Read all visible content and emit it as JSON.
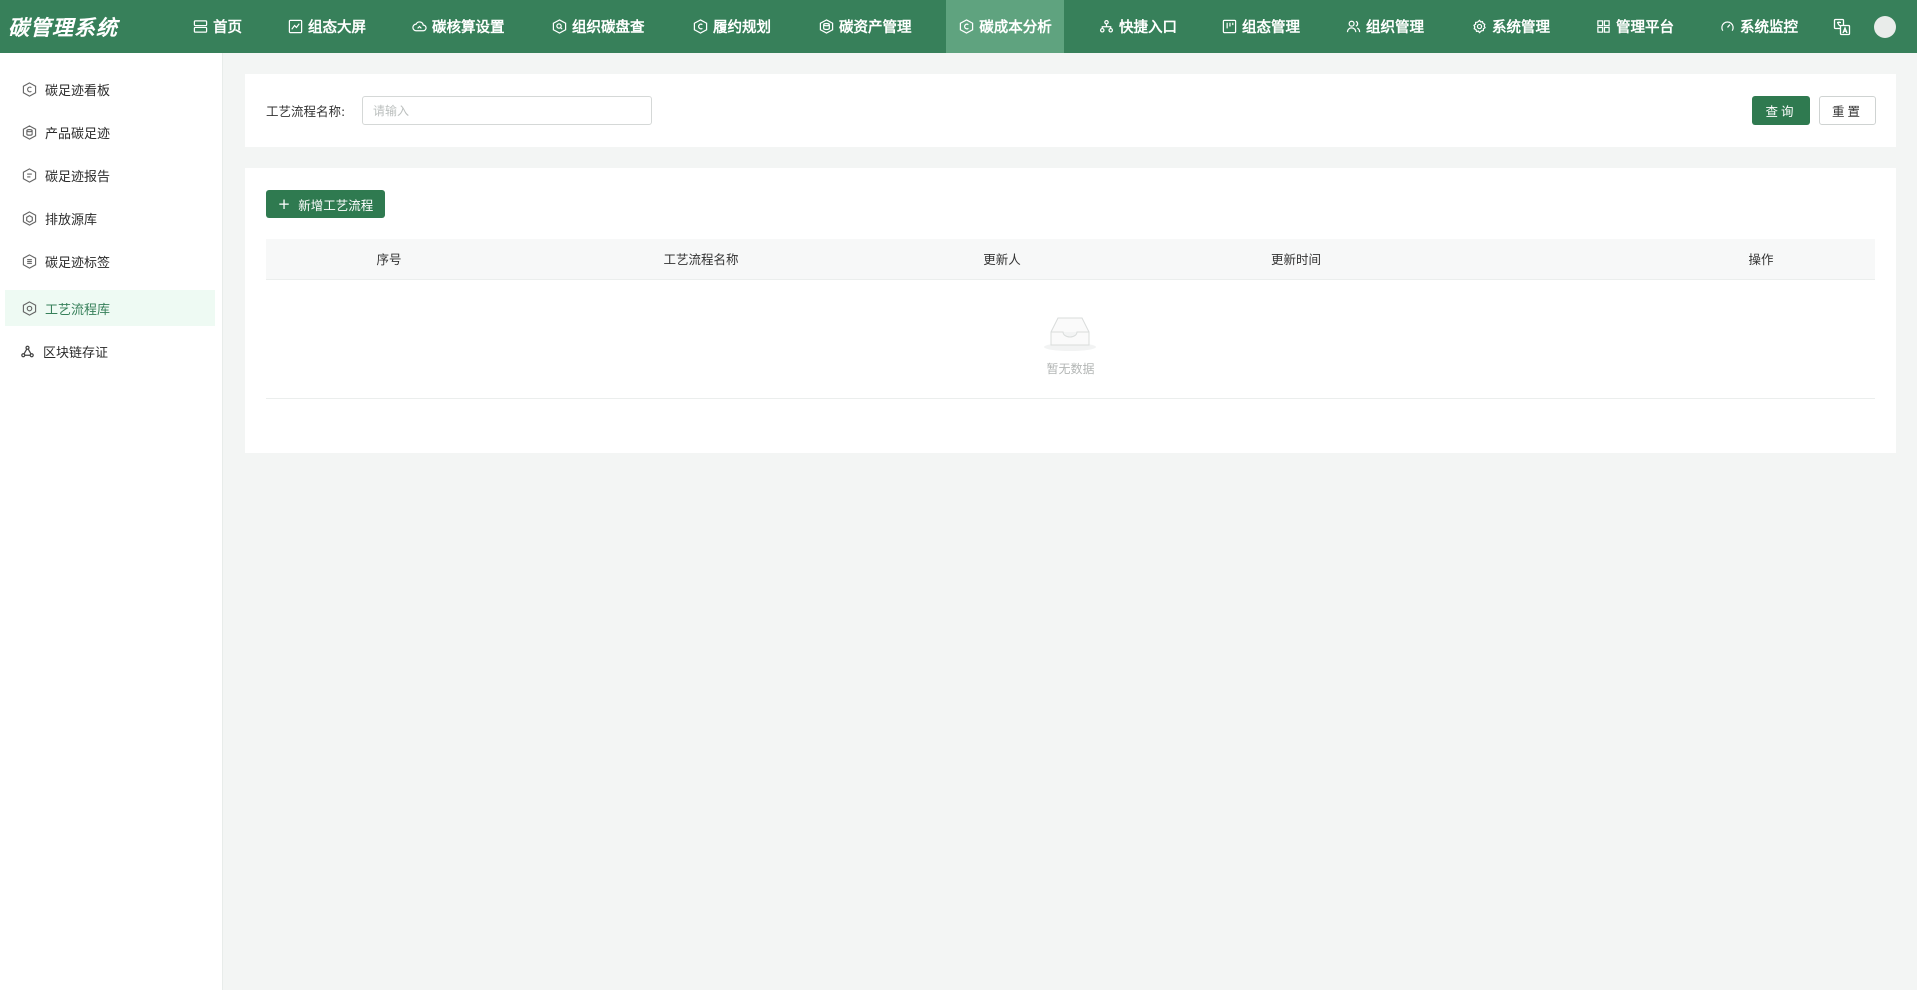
{
  "app": {
    "title": "碳管理系统"
  },
  "nav": {
    "items": [
      {
        "label": "首页",
        "icon": "server-icon"
      },
      {
        "label": "组态大屏",
        "icon": "chart-line-icon"
      },
      {
        "label": "碳核算设置",
        "icon": "cloud-icon"
      },
      {
        "label": "组织碳盘查",
        "icon": "search-hex-icon"
      },
      {
        "label": "履约规划",
        "icon": "carbon-hex-icon"
      },
      {
        "label": "碳资产管理",
        "icon": "database-hex-icon"
      },
      {
        "label": "碳成本分析",
        "icon": "carbon-circle-icon",
        "active": true
      },
      {
        "label": "快捷入口",
        "icon": "network-icon"
      },
      {
        "label": "组态管理",
        "icon": "layout-icon"
      },
      {
        "label": "组织管理",
        "icon": "users-icon"
      },
      {
        "label": "系统管理",
        "icon": "gear-icon"
      },
      {
        "label": "管理平台",
        "icon": "grid-icon"
      },
      {
        "label": "系统监控",
        "icon": "gauge-icon"
      }
    ]
  },
  "sidebar": {
    "items": [
      {
        "label": "碳足迹看板",
        "icon": "carbon-hex-icon"
      },
      {
        "label": "产品碳足迹",
        "icon": "product-hex-icon"
      },
      {
        "label": "碳足迹报告",
        "icon": "report-hex-icon"
      },
      {
        "label": "排放源库",
        "icon": "source-hex-icon"
      },
      {
        "label": "碳足迹标签",
        "icon": "tag-hex-icon"
      },
      {
        "label": "工艺流程库",
        "icon": "process-hex-icon",
        "active": true
      },
      {
        "label": "区块链存证",
        "icon": "blockchain-icon"
      }
    ]
  },
  "search": {
    "label": "工艺流程名称:",
    "placeholder": "请输入",
    "value": "",
    "query_label": "查询",
    "reset_label": "重置"
  },
  "table": {
    "add_label": "新增工艺流程",
    "columns": [
      "序号",
      "工艺流程名称",
      "更新人",
      "更新时间",
      "操作"
    ],
    "rows": [],
    "empty_text": "暂无数据"
  },
  "colors": {
    "brand": "#37805a",
    "nav_active": "#5fa37f",
    "primary_button": "#2f7a50",
    "sidebar_active_bg": "#eefaf3"
  }
}
